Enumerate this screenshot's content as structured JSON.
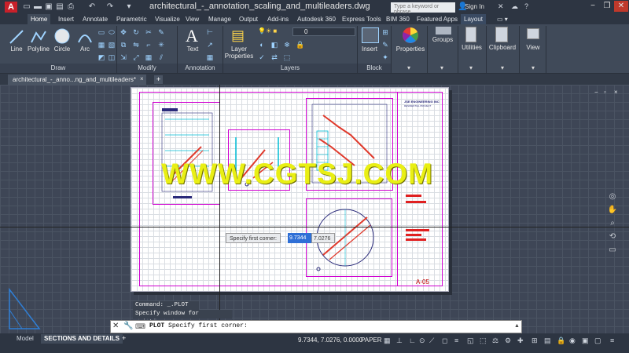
{
  "app": {
    "logo": "A",
    "document_title": "architectural_-_annotation_scaling_and_multileaders.dwg",
    "search_placeholder": "Type a keyword or phrase",
    "sign_in": "Sign In"
  },
  "ribbon_tabs": [
    "Home",
    "Insert",
    "Annotate",
    "Parametric",
    "Visualize",
    "View",
    "Manage",
    "Output",
    "Add-ins",
    "Autodesk 360",
    "Express Tools",
    "BIM 360",
    "Featured Apps",
    "Layout"
  ],
  "active_ribbon_tab": "Home",
  "draw_tools": [
    "Line",
    "Polyline",
    "Circle",
    "Arc"
  ],
  "panel_titles": {
    "draw": "Draw",
    "modify": "Modify",
    "annotation": "Annotation",
    "layers": "Layers",
    "block": "Block"
  },
  "tools": {
    "text": "Text",
    "layer_properties_1": "Layer",
    "layer_properties_2": "Properties",
    "layer_current": "0",
    "insert": "Insert",
    "properties": "Properties",
    "groups": "Groups",
    "utilities": "Utilities",
    "clipboard": "Clipboard",
    "view": "View"
  },
  "document_tab": {
    "label": "architectural_-_anno...ng_and_multileaders*",
    "close": "×",
    "add": "+"
  },
  "viewport_controls": {
    "minimize": "−",
    "restore": "▫",
    "close": "×"
  },
  "watermark": "WWW.CGTSJ.COM",
  "dynamic_input": {
    "prompt": "Specify first corner:",
    "x": "9.7344",
    "y": "7.0276"
  },
  "sheet_number": "A-05",
  "title_block": {
    "company": "JSE ENGINEERING INC",
    "subtitle": "RESIDENTIAL PROJECT"
  },
  "command_history": [
    "Command: _.PLOT",
    "Specify window for printing"
  ],
  "command_line": {
    "command": "PLOT",
    "prompt": "Specify first corner:"
  },
  "layout_tabs": [
    "Model",
    "SECTIONS AND DETAILS"
  ],
  "active_layout_tab": "SECTIONS AND DETAILS",
  "status": {
    "coordinates": "9.7344, 7.0276, 0.0000",
    "space": "PAPER"
  },
  "colors": {
    "accent": "#c8202a",
    "selection": "#2f6fd6",
    "watermark": "#e9ef14",
    "magenta": "#d000d0"
  }
}
